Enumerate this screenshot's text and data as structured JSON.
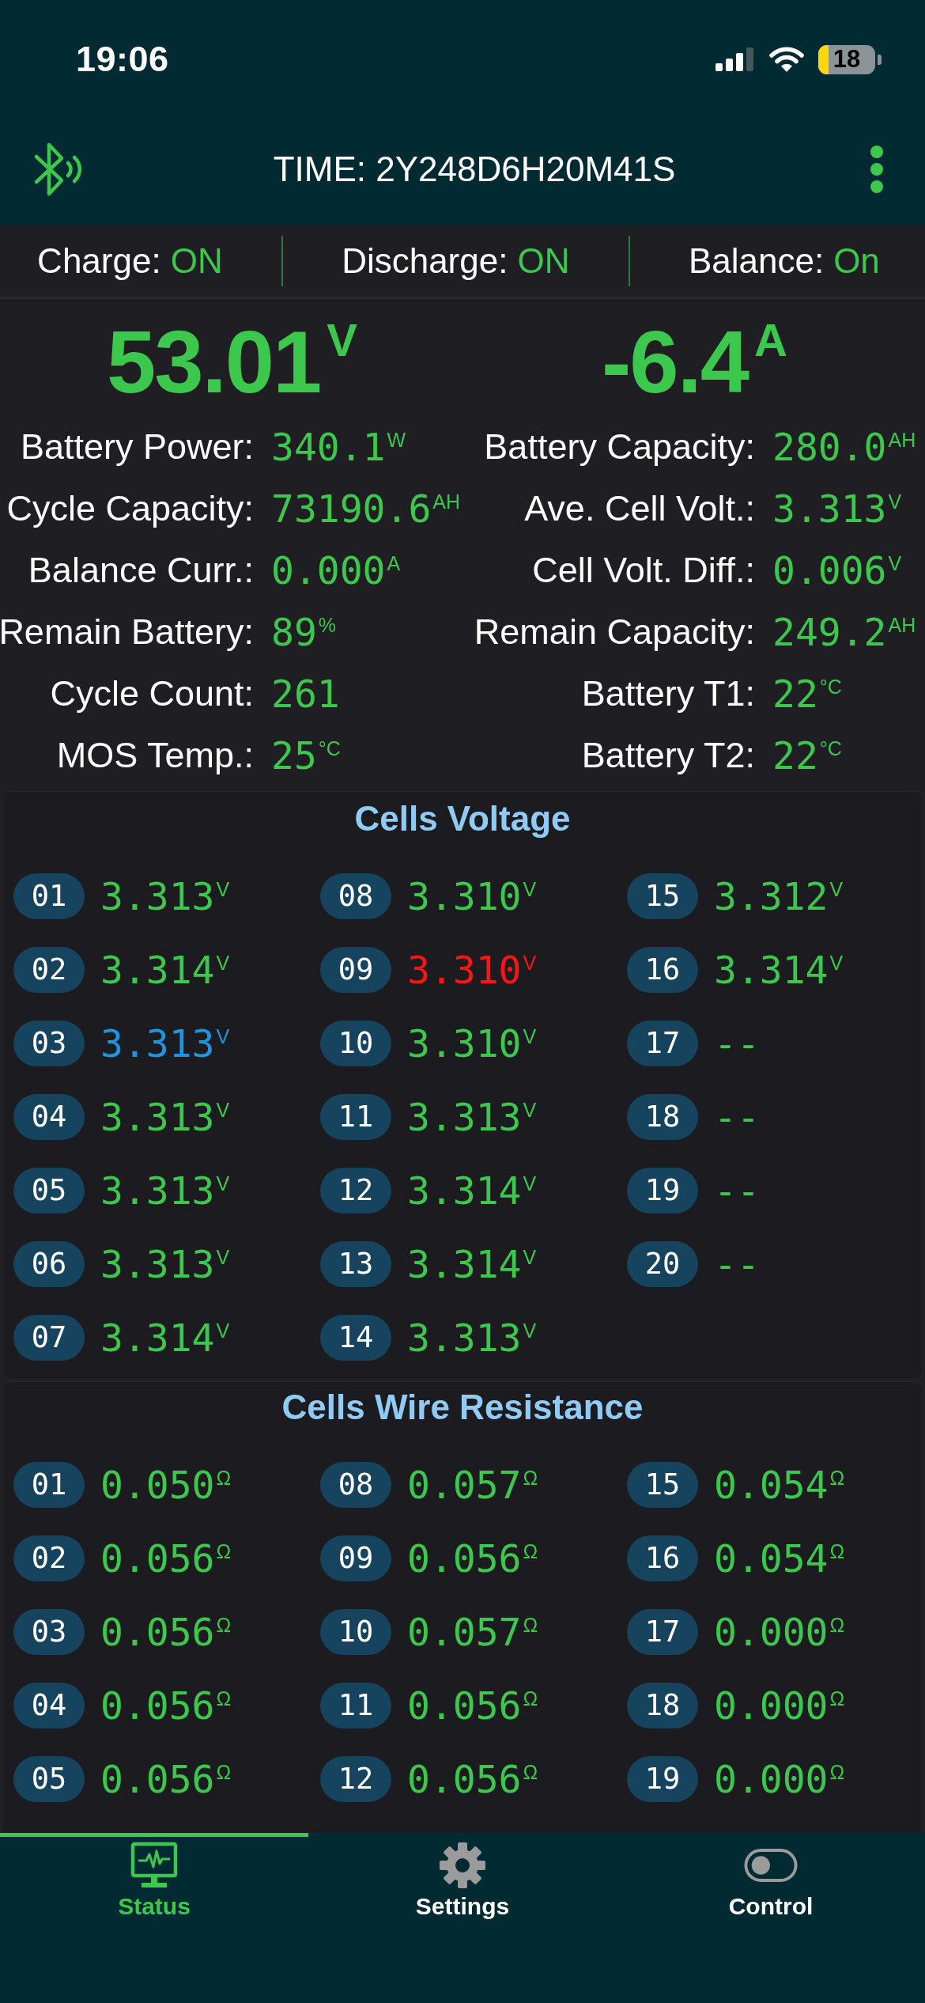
{
  "status_bar": {
    "time": "19:06",
    "battery": "18"
  },
  "header": {
    "title": "TIME: 2Y248D6H20M41S"
  },
  "switches": [
    {
      "label": "Charge:",
      "value": "ON",
      "on": true
    },
    {
      "label": "Discharge:",
      "value": "ON",
      "on": true
    },
    {
      "label": "Balance:",
      "value": "On",
      "on": true
    }
  ],
  "readings": {
    "voltage": "53.01$^{V}$",
    "current": "-6.4$^{A}$"
  },
  "stats": [
    {
      "label": "Battery Power:",
      "value": "340.1$^{W}$"
    },
    {
      "label": "Battery Capacity:",
      "value": "280.0$^{AH}$"
    },
    {
      "label": "Cycle Capacity:",
      "value": "73190.6$^{AH}$"
    },
    {
      "label": "Ave. Cell Volt.:",
      "value": "3.313$^{V}$"
    },
    {
      "label": "Balance Curr.:",
      "value": "0.000$^{A}$"
    },
    {
      "label": "Cell Volt. Diff.:",
      "value": "0.006$^{V}$"
    },
    {
      "label": "Remain Battery:",
      "value": "89$^{%}$"
    },
    {
      "label": "Remain Capacity:",
      "value": "249.2$^{AH}$"
    },
    {
      "label": "Cycle Count:",
      "value": "261"
    },
    {
      "label": "Battery T1:",
      "value": "22$^{°C}$"
    },
    {
      "label": "MOS Temp.:",
      "value": "25$^{°C}$"
    },
    {
      "label": "Battery T2:",
      "value": "22$^{°C}$"
    }
  ],
  "cells_voltage": {
    "title": "Cells Voltage",
    "cells": [
      {
        "number": "01",
        "value": "3.313$^{V}$",
        "color": "#3cc84d"
      },
      {
        "number": "02",
        "value": "3.314$^{V}$",
        "color": "#3cc84d"
      },
      {
        "number": "03",
        "value": "3.313$^{V}$",
        "color": "#1c96e0"
      },
      {
        "number": "04",
        "value": "3.313$^{V}$",
        "color": "#3cc84d"
      },
      {
        "number": "05",
        "value": "3.313$^{V}$",
        "color": "#3cc84d"
      },
      {
        "number": "06",
        "value": "3.313$^{V}$",
        "color": "#3cc84d"
      },
      {
        "number": "07",
        "value": "3.314$^{V}$",
        "color": "#3cc84d"
      },
      {
        "number": "08",
        "value": "3.310$^{V}$",
        "color": "#3cc84d"
      },
      {
        "number": "09",
        "value": "3.310$^{V}$",
        "color": "#ff1414"
      },
      {
        "number": "10",
        "value": "3.310$^{V}$",
        "color": "#3cc84d"
      },
      {
        "number": "11",
        "value": "3.313$^{V}$",
        "color": "#3cc84d"
      },
      {
        "number": "12",
        "value": "3.314$^{V}$",
        "color": "#3cc84d"
      },
      {
        "number": "13",
        "value": "3.314$^{V}$",
        "color": "#3cc84d"
      },
      {
        "number": "14",
        "value": "3.313$^{V}$",
        "color": "#3cc84d"
      },
      {
        "number": "15",
        "value": "3.312$^{V}$",
        "color": "#3cc84d"
      },
      {
        "number": "16",
        "value": "3.314$^{V}$",
        "color": "#3cc84d"
      },
      {
        "number": "17",
        "value": "--",
        "color": "#3cc84d"
      },
      {
        "number": "18",
        "value": "--",
        "color": "#3cc84d"
      },
      {
        "number": "19",
        "value": "--",
        "color": "#3cc84d"
      },
      {
        "number": "20",
        "value": "--",
        "color": "#3cc84d"
      }
    ]
  },
  "cells_wire_resistance": {
    "title": "Cells Wire Resistance",
    "cells": [
      {
        "number": "01",
        "value": "0.050$^{Ω}$"
      },
      {
        "number": "02",
        "value": "0.056$^{Ω}$"
      },
      {
        "number": "03",
        "value": "0.056$^{Ω}$"
      },
      {
        "number": "04",
        "value": "0.056$^{Ω}$"
      },
      {
        "number": "05",
        "value": "0.056$^{Ω}$"
      },
      {
        "number": "08",
        "value": "0.057$^{Ω}$"
      },
      {
        "number": "09",
        "value": "0.056$^{Ω}$"
      },
      {
        "number": "10",
        "value": "0.057$^{Ω}$"
      },
      {
        "number": "11",
        "value": "0.056$^{Ω}$"
      },
      {
        "number": "12",
        "value": "0.056$^{Ω}$"
      },
      {
        "number": "15",
        "value": "0.054$^{Ω}$"
      },
      {
        "number": "16",
        "value": "0.054$^{Ω}$"
      },
      {
        "number": "17",
        "value": "0.000$^{Ω}$"
      },
      {
        "number": "18",
        "value": "0.000$^{Ω}$"
      },
      {
        "number": "19",
        "value": "0.000$^{Ω}$"
      }
    ]
  },
  "tabs": [
    {
      "label": "Status",
      "selected": true
    },
    {
      "label": "Settings",
      "selected": false
    },
    {
      "label": "Control",
      "selected": false
    }
  ]
}
